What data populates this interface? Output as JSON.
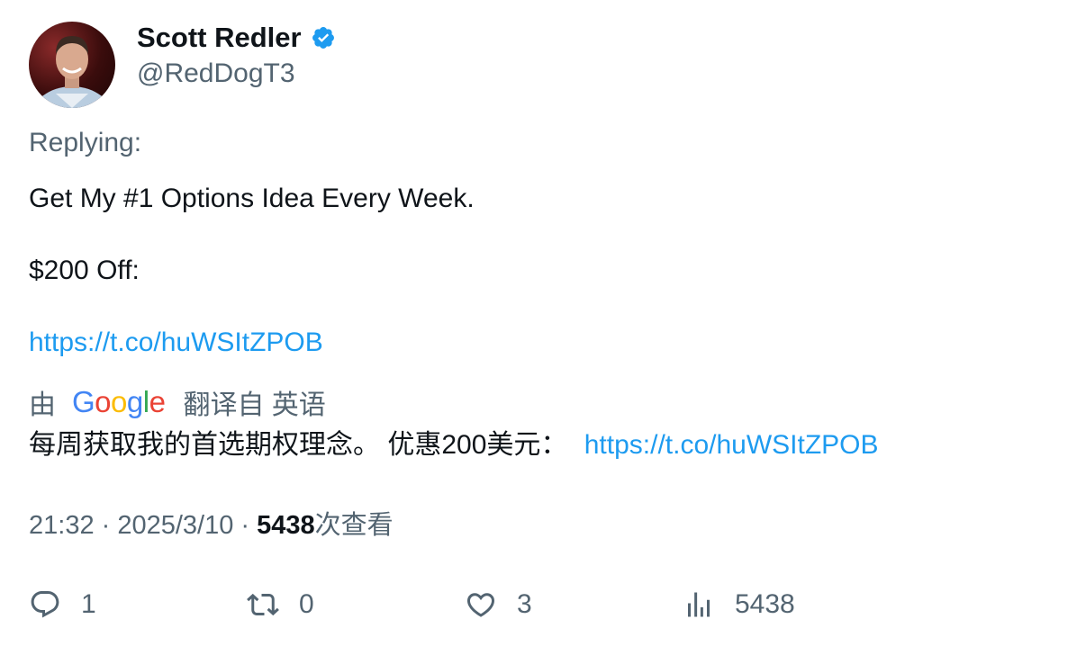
{
  "author": {
    "display_name": "Scott Redler",
    "handle": "@RedDogT3",
    "verified_icon": "verified-badge-icon",
    "verified_color": "#1d9bf0"
  },
  "replying_label": "Replying:",
  "tweet": {
    "line1": "Get My #1 Options Idea Every Week.",
    "line2": "$200 Off:",
    "link": "https://t.co/huWSItZPOB"
  },
  "translation": {
    "prefix": "由",
    "google": [
      "G",
      "o",
      "o",
      "g",
      "l",
      "e"
    ],
    "google_colors": [
      "#4285f4",
      "#ea4335",
      "#fbbc05",
      "#4285f4",
      "#34a853",
      "#ea4335"
    ],
    "suffix": "翻译自 英语",
    "text": "每周获取我的首选期权理念。 优惠200美元：",
    "link": "https://t.co/huWSItZPOB"
  },
  "meta": {
    "time": "21:32",
    "sep1": " · ",
    "date": "2025/3/10",
    "sep2": " · ",
    "views": "5438",
    "views_label": "次查看"
  },
  "actions": {
    "replies": "1",
    "retweets": "0",
    "likes": "3",
    "views": "5438"
  },
  "colors": {
    "text": "#0f1419",
    "secondary": "#536471",
    "link": "#1d9bf0"
  }
}
